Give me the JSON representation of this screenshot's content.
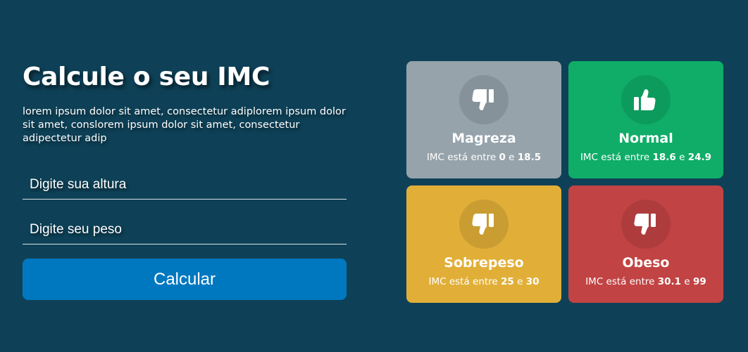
{
  "form": {
    "title": "Calcule o seu IMC",
    "description": "lorem ipsum dolor sit amet, consectetur adiplorem ipsum dolor sit amet, conslorem ipsum dolor sit amet, consectetur adipectetur adip",
    "height_placeholder": "Digite sua altura",
    "weight_placeholder": "Digite seu peso",
    "submit_label": "Calcular"
  },
  "cards": [
    {
      "title": "Magreza",
      "prefix": "IMC está entre",
      "min": "0",
      "joiner": "e",
      "max": "18.5",
      "icon": "thumbs-down-icon",
      "color": "#96a3ab"
    },
    {
      "title": "Normal",
      "prefix": "IMC está entre",
      "min": "18.6",
      "joiner": "e",
      "max": "24.9",
      "icon": "thumbs-up-icon",
      "color": "#0fad68"
    },
    {
      "title": "Sobrepeso",
      "prefix": "IMC está entre",
      "min": "25",
      "joiner": "e",
      "max": "30",
      "icon": "thumbs-down-icon",
      "color": "#e1af38"
    },
    {
      "title": "Obeso",
      "prefix": "IMC está entre",
      "min": "30.1",
      "joiner": "e",
      "max": "99",
      "icon": "thumbs-down-icon",
      "color": "#c24343"
    }
  ],
  "colors": {
    "background": "#0e4157",
    "button": "#0078c0"
  }
}
